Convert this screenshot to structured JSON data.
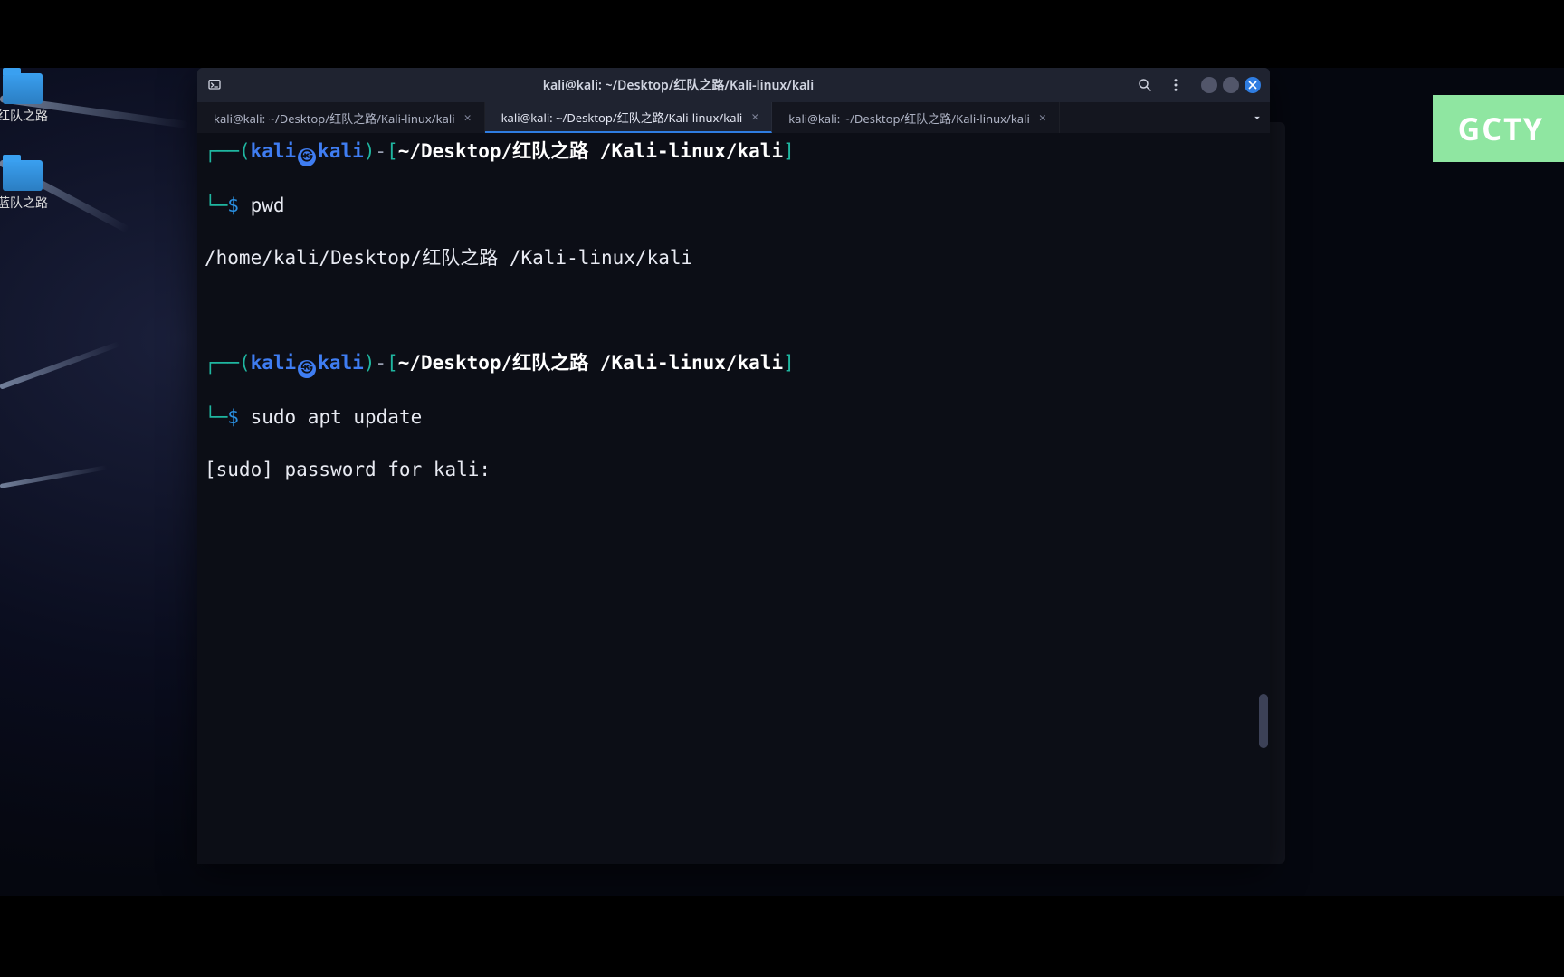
{
  "desktop": {
    "icons": [
      {
        "label": "红队之路"
      },
      {
        "label": "蓝队之路"
      }
    ]
  },
  "watermark": {
    "text": "GCTY"
  },
  "window": {
    "title": "kali@kali: ~/Desktop/红队之路/Kali-linux/kali",
    "tabs": [
      {
        "label": "kali@kali: ~/Desktop/红队之路/Kali-linux/kali",
        "active": false
      },
      {
        "label": "kali@kali: ~/Desktop/红队之路/Kali-linux/kali",
        "active": true
      },
      {
        "label": "kali@kali: ~/Desktop/红队之路/Kali-linux/kali",
        "active": false
      }
    ]
  },
  "terminal": {
    "prompt": {
      "user": "kali",
      "host": "kali",
      "path_prefix": "~",
      "path": "/Desktop/红队之路 /Kali-linux/kali"
    },
    "blocks": [
      {
        "command": "pwd",
        "output": "/home/kali/Desktop/红队之路 /Kali-linux/kali"
      },
      {
        "command": "sudo apt update",
        "output": "[sudo] password for kali: "
      }
    ]
  }
}
